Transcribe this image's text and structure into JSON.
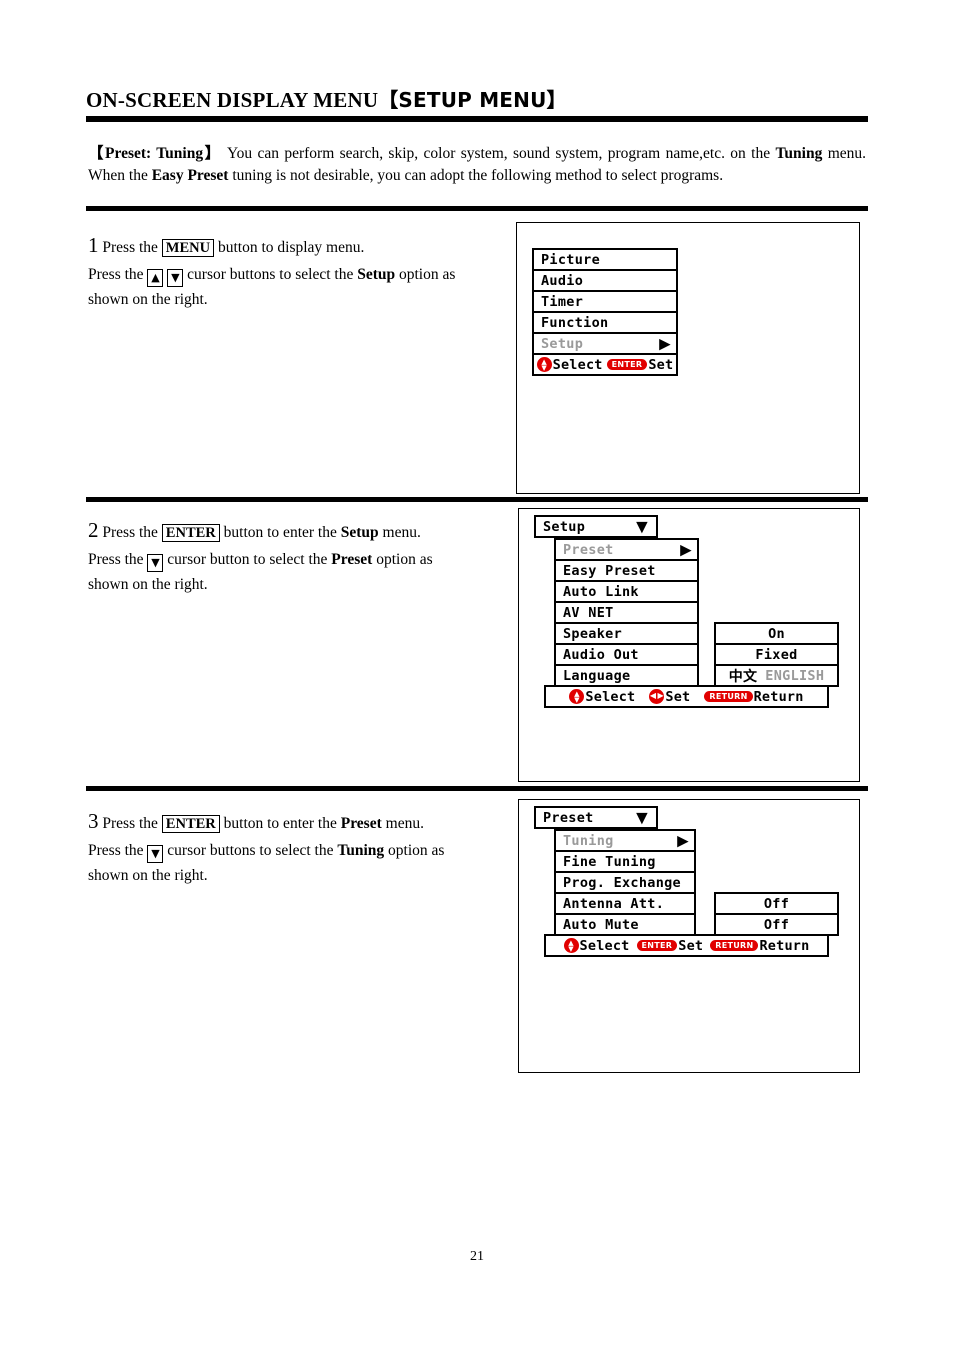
{
  "header": {
    "title_main": "ON-SCREEN DISPLAY MENU",
    "title_bracketed": "SETUP MENU",
    "bracket_open": "【",
    "bracket_close": "】"
  },
  "intro": {
    "lead_bracket_open": "【",
    "lead": "Preset: Tuning",
    "lead_bracket_close": "】",
    "text_1": " You can perform search, skip, color system, sound system, program name,etc. on the ",
    "bold_1": "Tuning",
    "text_2": " menu. When the ",
    "bold_2": "Easy Preset",
    "text_3": " tuning is not desirable, you can adopt the following method to select programs."
  },
  "steps": [
    {
      "number": "1",
      "line1_a": "Press the ",
      "line1_key": "MENU",
      "line1_b": " button to display menu.",
      "line2_a": "Press the ",
      "line2_keys": [
        "▲",
        "▼"
      ],
      "line2_b": " cursor buttons to select the ",
      "line2_bold": "Setup",
      "line2_c": " option as",
      "line3": "shown on the right."
    },
    {
      "number": "2",
      "line1_a": "Press the ",
      "line1_key": "ENTER",
      "line1_b": " button to enter the ",
      "line1_bold": "Setup",
      "line1_c": " menu.",
      "line2_a": "Press the ",
      "line2_keys": [
        "▼"
      ],
      "line2_b": " cursor button to select the ",
      "line2_bold": "Preset",
      "line2_c": " option as",
      "line3": "shown on the right."
    },
    {
      "number": "3",
      "line1_a": "Press the ",
      "line1_key": "ENTER",
      "line1_b": " button to enter the ",
      "line1_bold": "Preset",
      "line1_c": " menu.",
      "line2_a": "Press the ",
      "line2_keys": [
        "▼"
      ],
      "line2_b": " cursor buttons to select the ",
      "line2_bold": "Tuning",
      "line2_c": " option as",
      "line3": "shown on the right."
    }
  ],
  "osd1": {
    "items": [
      {
        "label": "Picture",
        "dim": false,
        "arrow": ""
      },
      {
        "label": "Audio",
        "dim": false,
        "arrow": ""
      },
      {
        "label": "Timer",
        "dim": false,
        "arrow": ""
      },
      {
        "label": "Function",
        "dim": false,
        "arrow": ""
      },
      {
        "label": "Setup",
        "dim": true,
        "arrow": "▶"
      }
    ],
    "hint": {
      "select_label": "Select",
      "enter_pill": "ENTER",
      "set_label": "Set"
    }
  },
  "osd2": {
    "title": "Setup",
    "title_arrow": "▼",
    "items": [
      {
        "label": "Preset",
        "dim": true,
        "arrow": "▶",
        "value": ""
      },
      {
        "label": "Easy Preset",
        "dim": false,
        "arrow": "",
        "value": ""
      },
      {
        "label": "Auto Link",
        "dim": false,
        "arrow": "",
        "value": ""
      },
      {
        "label": "AV NET",
        "dim": false,
        "arrow": "",
        "value": ""
      },
      {
        "label": "Speaker",
        "dim": false,
        "arrow": "",
        "value": "On"
      },
      {
        "label": "Audio Out",
        "dim": false,
        "arrow": "",
        "value": "Fixed"
      }
    ],
    "language_row": {
      "label": "Language",
      "value_selected": "中文",
      "value_other": "ENGLISH"
    },
    "hint": {
      "select_label": "Select",
      "set_label": "Set",
      "return_pill": "RETURN",
      "return_label": "Return"
    }
  },
  "osd3": {
    "title": "Preset",
    "title_arrow": "▼",
    "items": [
      {
        "label": "Tuning",
        "dim": true,
        "arrow": "▶",
        "value": ""
      },
      {
        "label": "Fine Tuning",
        "dim": false,
        "arrow": "",
        "value": ""
      },
      {
        "label": "Prog. Exchange",
        "dim": false,
        "arrow": "",
        "value": ""
      },
      {
        "label": "Antenna Att.",
        "dim": false,
        "arrow": "",
        "value": "Off"
      },
      {
        "label": "Auto Mute",
        "dim": false,
        "arrow": "",
        "value": "Off"
      }
    ],
    "hint": {
      "select_label": "Select",
      "enter_pill": "ENTER",
      "set_label": "Set",
      "return_pill": "RETURN",
      "return_label": "Return"
    }
  },
  "footer": {
    "page_number": "21"
  },
  "colors": {
    "accent_red": "#e10000",
    "dim_grey": "#9a9a9a",
    "ink": "#000000"
  }
}
